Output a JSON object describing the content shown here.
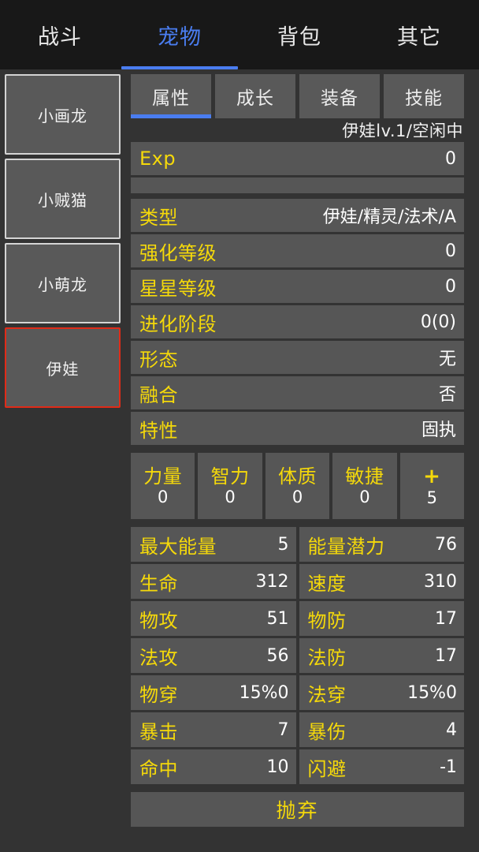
{
  "theme": {
    "bg": "#333333",
    "topnav_bg": "#181818",
    "panel": "#565656",
    "card": "#595959",
    "accent_blue": "#4a7df0",
    "accent_yellow": "#f5d90a",
    "selected_red": "#e02b18",
    "text_white": "#ffffff"
  },
  "topnav": {
    "tabs": [
      {
        "label": "战斗",
        "active": false
      },
      {
        "label": "宠物",
        "active": true
      },
      {
        "label": "背包",
        "active": false
      },
      {
        "label": "其它",
        "active": false
      }
    ]
  },
  "sidebar": {
    "pets": [
      {
        "name": "小画龙",
        "selected": false
      },
      {
        "name": "小贼猫",
        "selected": false
      },
      {
        "name": "小萌龙",
        "selected": false
      },
      {
        "name": "伊娃",
        "selected": true
      }
    ]
  },
  "subtabs": {
    "tabs": [
      {
        "label": "属性",
        "active": true
      },
      {
        "label": "成长",
        "active": false
      },
      {
        "label": "装备",
        "active": false
      },
      {
        "label": "技能",
        "active": false
      }
    ]
  },
  "status": {
    "text": "伊娃lv.1/空闲中"
  },
  "exp": {
    "label": "Exp",
    "value": "0",
    "progress_percent": 0
  },
  "info_rows": [
    {
      "label": "类型",
      "value": "伊娃/精灵/法术/A"
    },
    {
      "label": "强化等级",
      "value": "0"
    },
    {
      "label": "星星等级",
      "value": "0"
    },
    {
      "label": "进化阶段",
      "value": "0(0)"
    },
    {
      "label": "形态",
      "value": "无"
    },
    {
      "label": "融合",
      "value": "否"
    },
    {
      "label": "特性",
      "value": "固执"
    }
  ],
  "attributes": [
    {
      "name": "力量",
      "value": "0"
    },
    {
      "name": "智力",
      "value": "0"
    },
    {
      "name": "体质",
      "value": "0"
    },
    {
      "name": "敏捷",
      "value": "0"
    },
    {
      "name": "+",
      "value": "5"
    }
  ],
  "stats": [
    {
      "label": "最大能量",
      "value": "5"
    },
    {
      "label": "能量潜力",
      "value": "76"
    },
    {
      "label": "生命",
      "value": "312"
    },
    {
      "label": "速度",
      "value": "310"
    },
    {
      "label": "物攻",
      "value": "51"
    },
    {
      "label": "物防",
      "value": "17"
    },
    {
      "label": "法攻",
      "value": "56"
    },
    {
      "label": "法防",
      "value": "17"
    },
    {
      "label": "物穿",
      "value": "15%0"
    },
    {
      "label": "法穿",
      "value": "15%0"
    },
    {
      "label": "暴击",
      "value": "7"
    },
    {
      "label": "暴伤",
      "value": "4"
    },
    {
      "label": "命中",
      "value": "10"
    },
    {
      "label": "闪避",
      "value": "-1"
    }
  ],
  "discard": {
    "label": "抛弃"
  }
}
